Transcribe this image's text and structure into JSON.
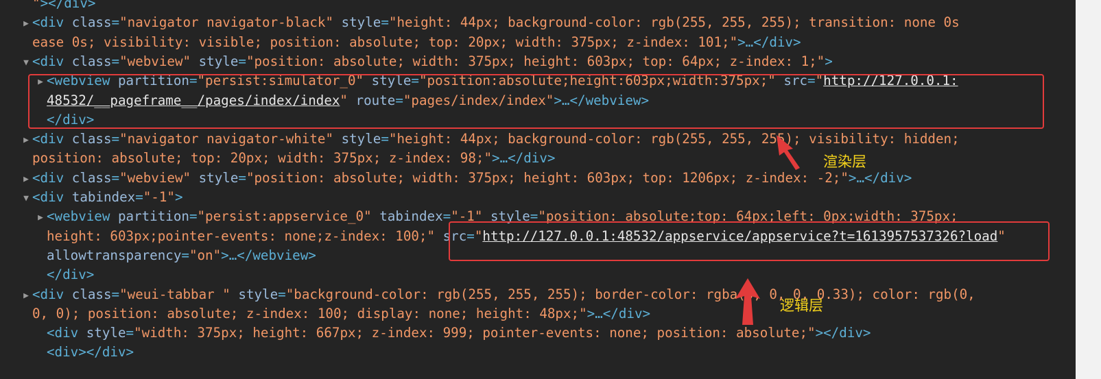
{
  "code_lines": [
    {
      "indent": 0,
      "tokens": [
        {
          "c": "val",
          "t": "\""
        },
        {
          "c": "tag",
          "t": "></div>"
        }
      ]
    },
    {
      "indent": 0,
      "tri": "right",
      "tokens": [
        {
          "c": "tag",
          "t": "<div "
        },
        {
          "c": "attr",
          "t": "class"
        },
        {
          "c": "tag",
          "t": "="
        },
        {
          "c": "val",
          "t": "\"navigator navigator-black\""
        },
        {
          "c": "tag",
          "t": " "
        },
        {
          "c": "attr",
          "t": "style"
        },
        {
          "c": "tag",
          "t": "="
        },
        {
          "c": "val",
          "t": "\"height: 44px; background-color: rgb(255, 255, 255); transition: none 0s"
        }
      ]
    },
    {
      "indent": 0,
      "tokens": [
        {
          "c": "val",
          "t": "ease 0s; visibility: visible; position: absolute; top: 20px; width: 375px; z-index: 101;\""
        },
        {
          "c": "tag",
          "t": ">…</div>"
        }
      ]
    },
    {
      "indent": 0,
      "tri": "down",
      "tokens": [
        {
          "c": "tag",
          "t": "<div "
        },
        {
          "c": "attr",
          "t": "class"
        },
        {
          "c": "tag",
          "t": "="
        },
        {
          "c": "val",
          "t": "\"webview\""
        },
        {
          "c": "tag",
          "t": " "
        },
        {
          "c": "attr",
          "t": "style"
        },
        {
          "c": "tag",
          "t": "="
        },
        {
          "c": "val",
          "t": "\"position: absolute; width: 375px; height: 603px; top: 64px; z-index: 1;\""
        },
        {
          "c": "tag",
          "t": ">"
        }
      ]
    },
    {
      "indent": 1,
      "tri": "right",
      "tokens": [
        {
          "c": "tag",
          "t": "<webview "
        },
        {
          "c": "attr",
          "t": "partition"
        },
        {
          "c": "tag",
          "t": "="
        },
        {
          "c": "val",
          "t": "\"persist:simulator_0\""
        },
        {
          "c": "tag",
          "t": " "
        },
        {
          "c": "attr",
          "t": "style"
        },
        {
          "c": "tag",
          "t": "="
        },
        {
          "c": "val",
          "t": "\"position:absolute;height:603px;width:375px;\""
        },
        {
          "c": "tag",
          "t": " "
        },
        {
          "c": "attr",
          "t": "src"
        },
        {
          "c": "tag",
          "t": "="
        },
        {
          "c": "val",
          "t": "\""
        },
        {
          "c": "link",
          "t": "http://127.0.0.1:"
        }
      ]
    },
    {
      "indent": 1,
      "tokens": [
        {
          "c": "link",
          "t": "48532/__pageframe__/pages/index/index"
        },
        {
          "c": "val",
          "t": "\""
        },
        {
          "c": "tag",
          "t": " "
        },
        {
          "c": "attr",
          "t": "route"
        },
        {
          "c": "tag",
          "t": "="
        },
        {
          "c": "val",
          "t": "\"pages/index/index\""
        },
        {
          "c": "tag",
          "t": ">…</webview>"
        }
      ]
    },
    {
      "indent": 1,
      "tokens": [
        {
          "c": "tag",
          "t": "</div>"
        }
      ]
    },
    {
      "indent": 0,
      "tri": "right",
      "tokens": [
        {
          "c": "tag",
          "t": "<div "
        },
        {
          "c": "attr",
          "t": "class"
        },
        {
          "c": "tag",
          "t": "="
        },
        {
          "c": "val",
          "t": "\"navigator navigator-white\""
        },
        {
          "c": "tag",
          "t": " "
        },
        {
          "c": "attr",
          "t": "style"
        },
        {
          "c": "tag",
          "t": "="
        },
        {
          "c": "val",
          "t": "\"height: 44px; background-color: rgb(255, 255, 255); visibility: hidden;"
        }
      ]
    },
    {
      "indent": 0,
      "tokens": [
        {
          "c": "val",
          "t": "position: absolute; top: 20px; width: 375px; z-index: 98;\""
        },
        {
          "c": "tag",
          "t": ">…</div>"
        }
      ]
    },
    {
      "indent": 0,
      "tri": "right",
      "tokens": [
        {
          "c": "tag",
          "t": "<div "
        },
        {
          "c": "attr",
          "t": "class"
        },
        {
          "c": "tag",
          "t": "="
        },
        {
          "c": "val",
          "t": "\"webview\""
        },
        {
          "c": "tag",
          "t": " "
        },
        {
          "c": "attr",
          "t": "style"
        },
        {
          "c": "tag",
          "t": "="
        },
        {
          "c": "val",
          "t": "\"position: absolute; width: 375px; height: 603px; top: 1206px; z-index: -2;\""
        },
        {
          "c": "tag",
          "t": ">…</div>"
        }
      ]
    },
    {
      "indent": 0,
      "tri": "down",
      "tokens": [
        {
          "c": "tag",
          "t": "<div "
        },
        {
          "c": "attr",
          "t": "tabindex"
        },
        {
          "c": "tag",
          "t": "="
        },
        {
          "c": "val",
          "t": "\"-1\""
        },
        {
          "c": "tag",
          "t": ">"
        }
      ]
    },
    {
      "indent": 1,
      "tri": "right",
      "tokens": [
        {
          "c": "tag",
          "t": "<webview "
        },
        {
          "c": "attr",
          "t": "partition"
        },
        {
          "c": "tag",
          "t": "="
        },
        {
          "c": "val",
          "t": "\"persist:appservice_0\""
        },
        {
          "c": "tag",
          "t": " "
        },
        {
          "c": "attr",
          "t": "tabindex"
        },
        {
          "c": "tag",
          "t": "="
        },
        {
          "c": "val",
          "t": "\"-1\""
        },
        {
          "c": "tag",
          "t": " "
        },
        {
          "c": "attr",
          "t": "style"
        },
        {
          "c": "tag",
          "t": "="
        },
        {
          "c": "val",
          "t": "\"position: absolute;top: 64px;left: 0px;width: 375px;"
        }
      ]
    },
    {
      "indent": 1,
      "tokens": [
        {
          "c": "val",
          "t": "height: 603px;pointer-events: none;z-index: 100;\""
        },
        {
          "c": "tag",
          "t": " "
        },
        {
          "c": "attr",
          "t": "src"
        },
        {
          "c": "tag",
          "t": "="
        },
        {
          "c": "val",
          "t": "\""
        },
        {
          "c": "link",
          "t": "http://127.0.0.1:48532/appservice/appservice?t=1613957537326?load"
        },
        {
          "c": "val",
          "t": "\""
        }
      ]
    },
    {
      "indent": 1,
      "tokens": [
        {
          "c": "attr",
          "t": "allowtransparency"
        },
        {
          "c": "tag",
          "t": "="
        },
        {
          "c": "val",
          "t": "\"on\""
        },
        {
          "c": "tag",
          "t": ">…</webview>"
        }
      ]
    },
    {
      "indent": 1,
      "tokens": [
        {
          "c": "tag",
          "t": "</div>"
        }
      ]
    },
    {
      "indent": 0,
      "tri": "right",
      "tokens": [
        {
          "c": "tag",
          "t": "<div "
        },
        {
          "c": "attr",
          "t": "class"
        },
        {
          "c": "tag",
          "t": "="
        },
        {
          "c": "val",
          "t": "\"weui-tabbar \""
        },
        {
          "c": "tag",
          "t": " "
        },
        {
          "c": "attr",
          "t": "style"
        },
        {
          "c": "tag",
          "t": "="
        },
        {
          "c": "val",
          "t": "\"background-color: rgb(255, 255, 255); border-color: rgba(0, 0, 0, 0.33); color: rgb(0,"
        }
      ]
    },
    {
      "indent": 0,
      "tokens": [
        {
          "c": "val",
          "t": "0, 0); position: absolute; z-index: 100; display: none; height: 48px;\""
        },
        {
          "c": "tag",
          "t": ">…</div>"
        }
      ]
    },
    {
      "indent": 1,
      "tokens": [
        {
          "c": "tag",
          "t": "<div "
        },
        {
          "c": "attr",
          "t": "style"
        },
        {
          "c": "tag",
          "t": "="
        },
        {
          "c": "val",
          "t": "\"width: 375px; height: 667px; z-index: 999; pointer-events: none; position: absolute;\""
        },
        {
          "c": "tag",
          "t": "></div>"
        }
      ]
    },
    {
      "indent": 1,
      "tokens": [
        {
          "c": "tag",
          "t": "<div></div>"
        }
      ]
    }
  ],
  "annotations": {
    "render_layer_label": "渲染层",
    "logic_layer_label": "逻辑层",
    "highlight_color": "#e23b3b",
    "label_color": "#f4d21c"
  },
  "icons": {
    "expand": "triangle-right-icon",
    "collapse": "triangle-down-icon"
  }
}
